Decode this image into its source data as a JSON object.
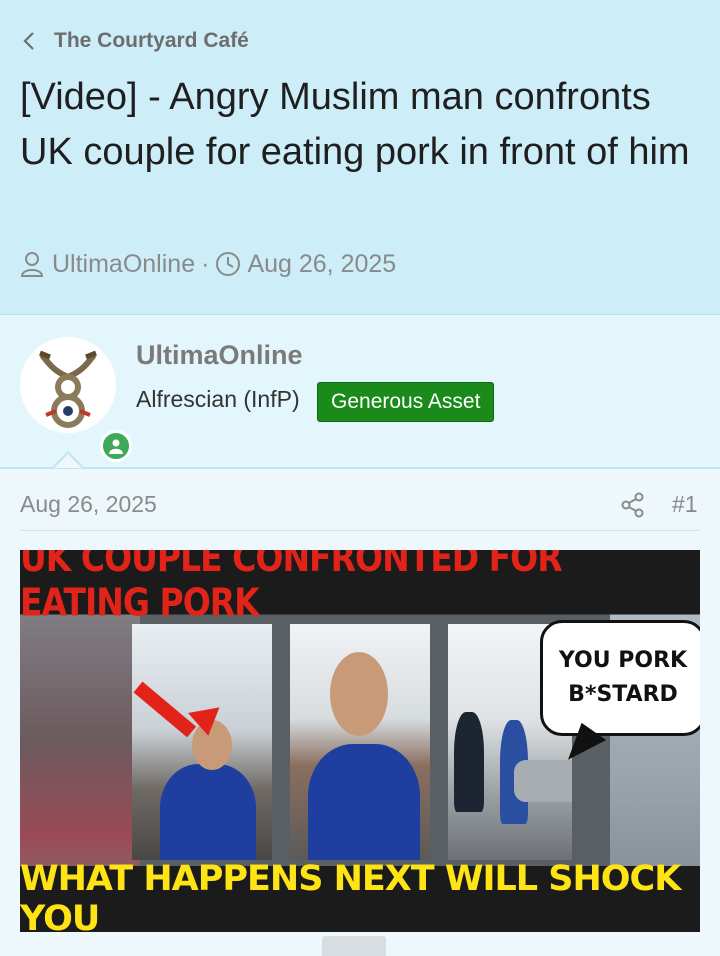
{
  "breadcrumb": {
    "label": "The Courtyard Café"
  },
  "thread": {
    "title": "[Video] - Angry Muslim man confronts UK couple for eating pork in front of him",
    "author": "UltimaOnline",
    "separator": "·",
    "date": "Aug 26, 2025"
  },
  "post": {
    "username": "UltimaOnline",
    "user_title": "Alfrescian (InfP)",
    "badge": "Generous Asset",
    "date": "Aug 26, 2025",
    "number": "#1",
    "thumbnail": {
      "top_text": "UK COUPLE CONFRONTED FOR EATING PORK",
      "bottom_text": "WHAT HAPPENS NEXT WILL SHOCK YOU",
      "bubble_line1": "YOU PORK",
      "bubble_line2": "B*STARD"
    }
  },
  "colors": {
    "header_bg": "#cdeef8",
    "badge_bg": "#1a8a1a",
    "online": "#3fa95a",
    "thumb_red": "#e2231a",
    "thumb_yellow": "#ffe415"
  },
  "icons": [
    "chevron-left-icon",
    "user-icon",
    "clock-icon",
    "share-icon",
    "online-status-icon"
  ]
}
